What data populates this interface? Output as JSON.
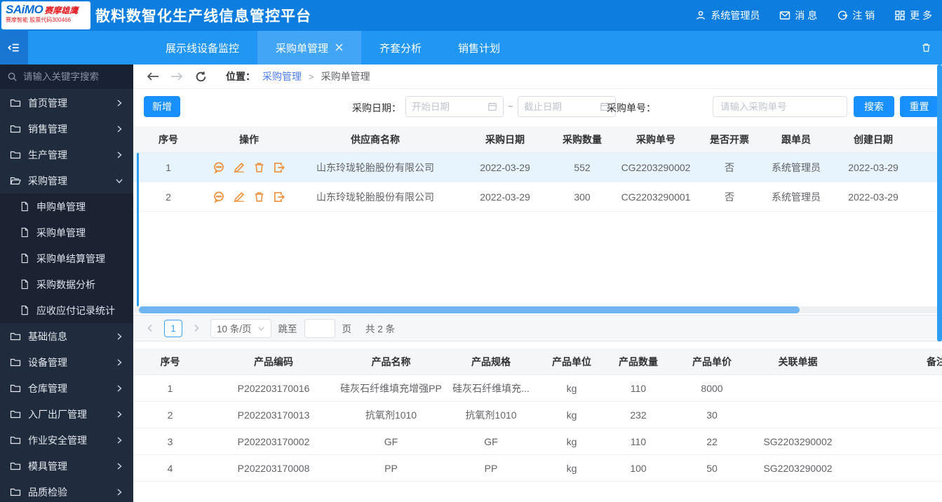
{
  "header": {
    "logo": {
      "brand": "SAiMO",
      "brand_cn": "赛摩雄鹰",
      "tagline": "赛摩智能 股票代码300466"
    },
    "title": "散料数智化生产线信息管控平台",
    "user": "系统管理员",
    "messages": "消 息",
    "logout": "注 销",
    "more": "更 多",
    "icons": [
      "user-icon",
      "mail-icon",
      "logout-icon",
      "grid-icon"
    ]
  },
  "tabbar": {
    "tabs": [
      {
        "label": "展示线设备监控",
        "active": false
      },
      {
        "label": "采购单管理",
        "active": true,
        "closable": true
      },
      {
        "label": "齐套分析",
        "active": false
      },
      {
        "label": "销售计划",
        "active": false
      }
    ],
    "icons": [
      "collapse-menu-icon",
      "trash-icon"
    ]
  },
  "sidebar": {
    "search_placeholder": "请输入关键字搜索",
    "items": [
      {
        "label": "首页管理",
        "state": "collapsed"
      },
      {
        "label": "销售管理",
        "state": "collapsed"
      },
      {
        "label": "生产管理",
        "state": "collapsed"
      },
      {
        "label": "采购管理",
        "state": "expanded",
        "children": [
          "申购单管理",
          "采购单管理",
          "采购单结算管理",
          "采购数据分析",
          "应收应付记录统计"
        ]
      },
      {
        "label": "基础信息",
        "state": "collapsed"
      },
      {
        "label": "设备管理",
        "state": "collapsed"
      },
      {
        "label": "仓库管理",
        "state": "collapsed"
      },
      {
        "label": "入厂出厂管理",
        "state": "collapsed"
      },
      {
        "label": "作业安全管理",
        "state": "collapsed"
      },
      {
        "label": "模具管理",
        "state": "collapsed"
      },
      {
        "label": "品质检验",
        "state": "collapsed"
      }
    ]
  },
  "breadcrumb": {
    "location_label": "位置：",
    "parent": "采购管理",
    "separator": ">",
    "current": "采购单管理",
    "icons": [
      "back-arrow-icon",
      "forward-arrow-icon",
      "refresh-icon"
    ]
  },
  "filters": {
    "add_button": "新增",
    "date_label": "采购日期：",
    "start_placeholder": "开始日期",
    "tilde": "~",
    "end_placeholder": "截止日期",
    "order_label": "采购单号：",
    "order_placeholder": "请输入采购单号",
    "search_button": "搜索",
    "reset_button": "重置"
  },
  "orders_table": {
    "columns": [
      "序号",
      "操作",
      "供应商名称",
      "采购日期",
      "采购数量",
      "采购单号",
      "是否开票",
      "跟单员",
      "创建日期"
    ],
    "action_icons": [
      "comment-icon",
      "edit-icon",
      "delete-icon",
      "export-icon"
    ],
    "rows": [
      {
        "index": "1",
        "supplier": "山东玲珑轮胎股份有限公司",
        "date": "2022-03-29",
        "qty": "552",
        "order_no": "CG2203290002",
        "invoiced": "否",
        "agent": "系统管理员",
        "created": "2022-03-29",
        "selected": true
      },
      {
        "index": "2",
        "supplier": "山东玲珑轮胎股份有限公司",
        "date": "2022-03-29",
        "qty": "300",
        "order_no": "CG2203290001",
        "invoiced": "否",
        "agent": "系统管理员",
        "created": "2022-03-29",
        "selected": false
      }
    ]
  },
  "pagination": {
    "page": "1",
    "page_size": "10 条/页",
    "jump_label": "跳至",
    "page_unit": "页",
    "total": "共 2 条"
  },
  "products_table": {
    "columns": [
      "序号",
      "产品编码",
      "产品名称",
      "产品规格",
      "产品单位",
      "产品数量",
      "产品单价",
      "关联单据",
      "备注"
    ],
    "rows": [
      [
        "1",
        "P202203170016",
        "硅灰石纤维填充增强PP",
        "硅灰石纤维填充...",
        "kg",
        "110",
        "8000",
        "",
        ""
      ],
      [
        "2",
        "P202203170013",
        "抗氧剂1010",
        "抗氧剂1010",
        "kg",
        "232",
        "30",
        "",
        ""
      ],
      [
        "3",
        "P202203170002",
        "GF",
        "GF",
        "kg",
        "110",
        "22",
        "SG2203290002",
        ""
      ],
      [
        "4",
        "P202203170008",
        "PP",
        "PP",
        "kg",
        "100",
        "50",
        "SG2203290002",
        ""
      ]
    ]
  },
  "colors": {
    "header_blue": "#0d7ee0",
    "tabbar_blue": "#2196f3",
    "active_tab_blue": "#42a5f5",
    "button_blue": "#1890ff",
    "sidebar_dark": "#202b3d",
    "action_orange": "#f0923d",
    "selected_row": "#e7f3fd",
    "link_blue": "#4d7bf3",
    "brand_red": "#e31e24"
  }
}
